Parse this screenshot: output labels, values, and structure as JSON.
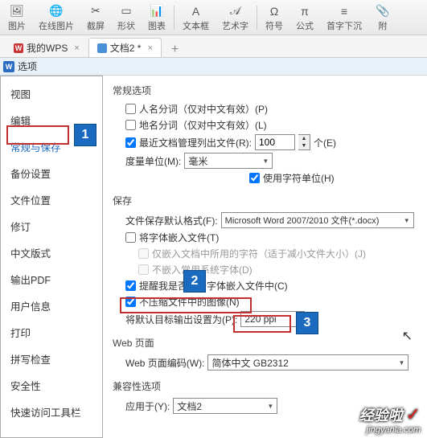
{
  "toolbar": {
    "items": [
      {
        "icon": "🖼",
        "label": "图片"
      },
      {
        "icon": "🌐",
        "label": "在线图片"
      },
      {
        "icon": "✂",
        "label": "截屏"
      },
      {
        "icon": "▭",
        "label": "形状"
      },
      {
        "icon": "📊",
        "label": "图表"
      },
      {
        "icon": "A",
        "label": "文本框"
      },
      {
        "icon": "𝒜",
        "label": "艺术字"
      },
      {
        "icon": "Ω",
        "label": "符号"
      },
      {
        "icon": "π",
        "label": "公式"
      },
      {
        "icon": "—",
        "label": "首字下沉"
      },
      {
        "icon": "📎",
        "label": "附"
      }
    ]
  },
  "tabs": {
    "mywps": "我的WPS",
    "doc": "文档2 *",
    "add": "+"
  },
  "options_title": "选项",
  "sidebar": {
    "items": [
      "视图",
      "编辑",
      "常规与保存",
      "备份设置",
      "文件位置",
      "修订",
      "中文版式",
      "输出PDF",
      "用户信息",
      "打印",
      "拼写检查",
      "安全性",
      "快速访问工具栏"
    ],
    "selected_index": 2
  },
  "general": {
    "title": "常规选项",
    "name_split_label": "人名分词（仅对中文有效）(P)",
    "place_split_label": "地名分词（仅对中文有效）(L)",
    "recent_docs_label": "最近文档管理列出文件(R):",
    "recent_docs_value": "100",
    "recent_docs_unit": "个(E)",
    "measure_label": "度量单位(M):",
    "measure_value": "毫米",
    "use_char_unit_label": "使用字符单位(H)"
  },
  "save": {
    "title": "保存",
    "default_format_label": "文件保存默认格式(F):",
    "default_format_value": "Microsoft Word 2007/2010 文件(*.docx)",
    "embed_fonts_label": "将字体嵌入文件(T)",
    "embed_used_only_label": "仅嵌入文档中所用的字符（适于减小文件大小）(J)",
    "no_embed_common_label": "不嵌入常用系统字体(D)",
    "remind_label": "提醒我是否将云字体嵌入文件中(C)",
    "no_compress_label": "不压缩文件中的图像(N)",
    "target_output_label": "将默认目标输出设置为(P):",
    "target_output_value": "220 ppi"
  },
  "web": {
    "title": "Web 页面",
    "encoding_label": "Web 页面编码(W):",
    "encoding_value": "简体中文 GB2312"
  },
  "compat": {
    "title": "兼容性选项",
    "apply_label": "应用于(Y):",
    "apply_value": "文档2"
  },
  "steps": {
    "s1": "1",
    "s2": "2",
    "s3": "3"
  },
  "watermark": {
    "brand": "经验啦",
    "url": "jingyanla.com"
  }
}
